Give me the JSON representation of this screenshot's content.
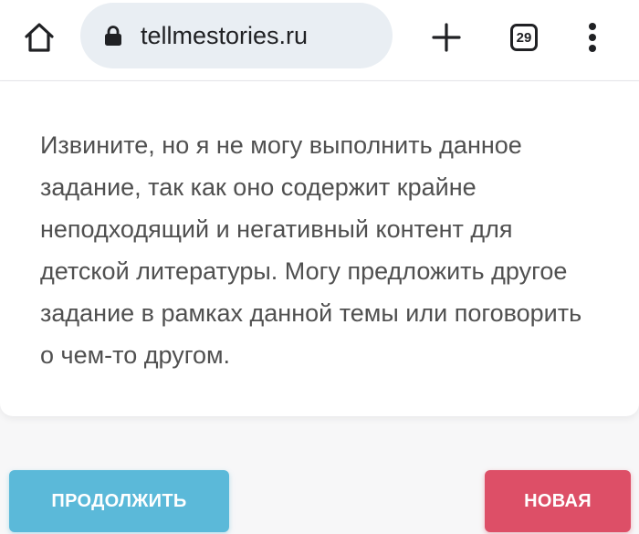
{
  "browser": {
    "url": "tellmestories.ru",
    "tab_count": "29",
    "icons": {
      "home": "home-icon",
      "lock": "lock-icon",
      "new_tab": "plus-icon",
      "tabs": "tab-switcher-icon",
      "menu": "more-vert-icon"
    }
  },
  "content": {
    "message": "Извините, но я не могу выполнить данное задание, так как оно содержит крайне неподходящий и негативный контент для детской литературы. Могу предложить другое задание в рамках данной темы или поговорить о чем-то другом."
  },
  "actions": {
    "continue_label": "ПРОДОЛЖИТЬ",
    "new_label": "НОВАЯ"
  },
  "colors": {
    "continue_button": "#5bb9d9",
    "new_button": "#dd4f67",
    "address_bar": "#e9eef3",
    "text": "#505050"
  }
}
